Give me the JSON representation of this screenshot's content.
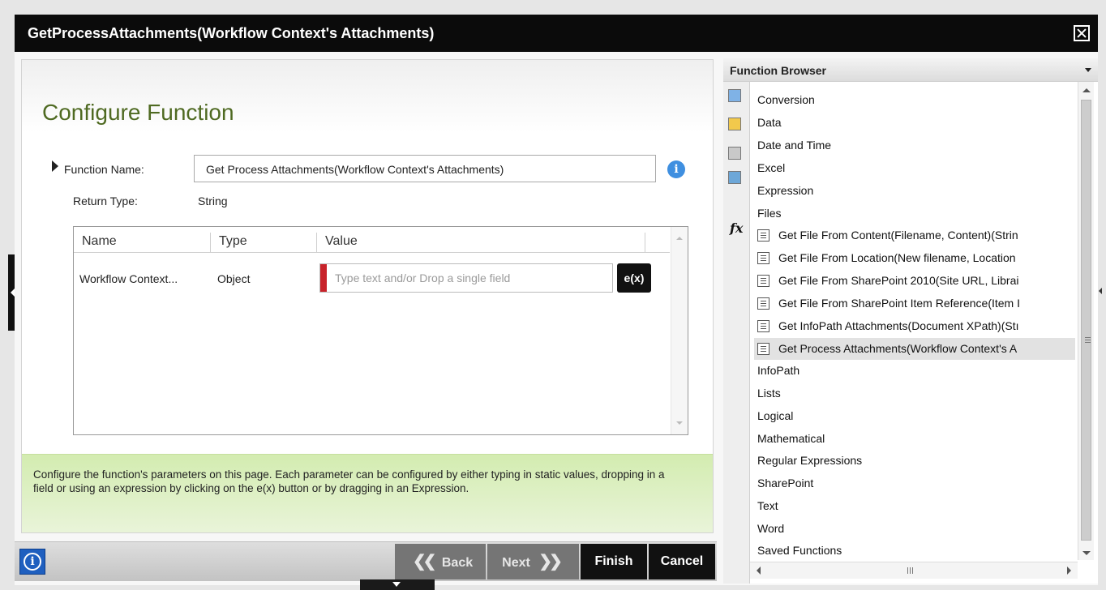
{
  "dialog": {
    "title": "GetProcessAttachments(Workflow Context's Attachments)"
  },
  "configure": {
    "heading": "Configure Function",
    "function_name_label": "Function Name:",
    "function_name_value": "Get Process Attachments(Workflow Context's Attachments)",
    "return_type_label": "Return Type:",
    "return_type_value": "String",
    "info_icon_glyph": "i"
  },
  "parameters": {
    "columns": [
      "Name",
      "Type",
      "Value"
    ],
    "rows": [
      {
        "name": "Workflow Context...",
        "type": "Object",
        "value_placeholder": "Type text and/or Drop a single field",
        "expression_button": "e(x)"
      }
    ]
  },
  "help": {
    "text": "Configure the function's parameters on this page.  Each parameter can be configured by either typing in static values, dropping in a field or using an expression by clicking on the e(x) button or by dragging in an Expression."
  },
  "footer": {
    "info_glyph": "i",
    "back_label": "Back",
    "next_label": "Next",
    "finish_label": "Finish",
    "cancel_label": "Cancel"
  },
  "function_browser": {
    "title": "Function Browser",
    "categories_before": [
      "Conversion",
      "Data",
      "Date and Time",
      "Excel",
      "Expression",
      "Files"
    ],
    "files_functions": [
      "Get File From Content(Filename, Content)(Strin",
      "Get File From Location(New filename, Location",
      "Get File From SharePoint 2010(Site URL, Librai",
      "Get File From SharePoint Item Reference(Item I",
      "Get InfoPath Attachments(Document XPath)(Stı",
      "Get Process Attachments(Workflow Context's A"
    ],
    "selected_function_index": 5,
    "categories_after": [
      "InfoPath",
      "Lists",
      "Logical",
      "Mathematical",
      "Regular Expressions",
      "SharePoint",
      "Text",
      "Word",
      "Saved Functions"
    ],
    "fx_label": "fx"
  },
  "colors": {
    "title_bar": "#0b0b0b",
    "heading_green": "#4f6a22",
    "help_box": "#dcefc4",
    "required_marker": "#c8222a",
    "info_blue": "#3f8fe0"
  }
}
